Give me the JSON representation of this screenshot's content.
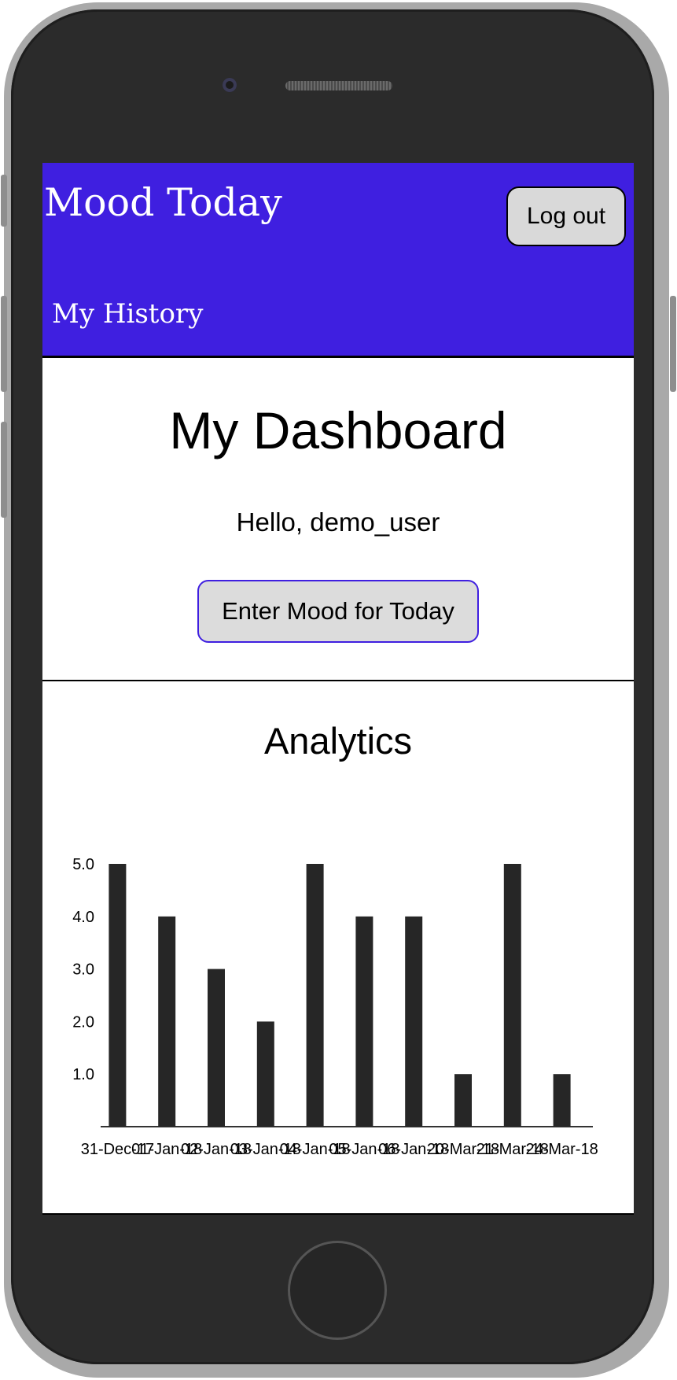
{
  "header": {
    "brand": "Mood Today",
    "logout_label": "Log out",
    "nav_history": "My History",
    "accent_color": "#3f1fe0"
  },
  "dashboard": {
    "title": "My Dashboard",
    "greeting": "Hello, demo_user",
    "enter_mood_label": "Enter Mood for Today"
  },
  "analytics": {
    "title": "Analytics"
  },
  "chart_data": {
    "type": "bar",
    "categories": [
      "31-Dec-17",
      "01-Jan-18",
      "02-Jan-18",
      "03-Jan-18",
      "04-Jan-18",
      "05-Jan-18",
      "06-Jan-18",
      "20-Mar-18",
      "21-Mar-18",
      "24-Mar-18"
    ],
    "values": [
      5,
      4,
      3,
      2,
      5,
      4,
      4,
      1,
      5,
      1
    ],
    "yticks": [
      "1.0",
      "2.0",
      "3.0",
      "4.0",
      "5.0"
    ],
    "ylim": [
      0,
      5
    ],
    "bar_color": "#262626",
    "grid": false
  }
}
